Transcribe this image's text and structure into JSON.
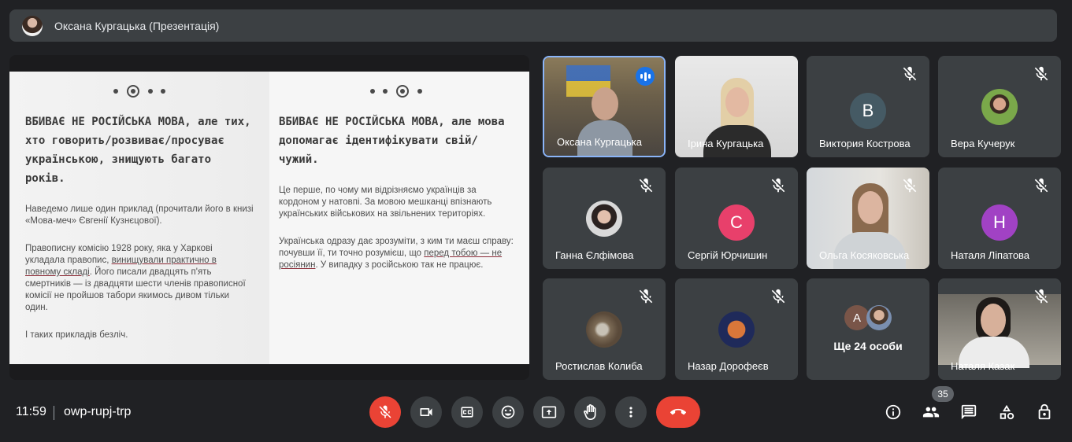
{
  "presenter": {
    "title": "Оксана Кургацька (Презентація)"
  },
  "slide": {
    "left_heading": "ВБИВАЄ НЕ РОСІЙСЬКА МОВА, але тих, хто говорить/розвиває/просуває українською, знищують багато років.",
    "left_p1": "Наведемо лише один приклад (прочитали його в книзі «Мова-меч» Євгенії Кузнєцової).",
    "left_p2a": "Правописну комісію 1928 року, яка у Харкові укладала правопис, ",
    "left_p2u": "винищували практично в повному складі",
    "left_p2b": ". Його писали двадцять п'ять смертників — із двадцяти шести членів правописної комісії не пройшов табори якимось дивом тільки один.",
    "left_p3": "І таких прикладів безліч.",
    "right_heading": "ВБИВАЄ НЕ РОСІЙСЬКА МОВА, але мова допомагає ідентифікувати свій/чужий.",
    "right_p1": "Це перше, по чому ми відрізняємо українців за кордоном у натовпі. За мовою мешканці впізнають українських військових на звільнених територіях.",
    "right_p2a": "Українська одразу дає зрозуміти, з ким ти маєш справу: почувши її, ти точно розумієш, що ",
    "right_p2u": "перед тобою — не росіянин",
    "right_p2b": ". У випадку з російською так не працює."
  },
  "tiles": [
    {
      "name": "Оксана Кургацька",
      "kind": "video",
      "active": true,
      "speaking": true
    },
    {
      "name": "Ірина Кургацька",
      "kind": "video"
    },
    {
      "name": "Виктория Кострова",
      "kind": "letter",
      "letter": "В",
      "color": "#455a64",
      "muted": true
    },
    {
      "name": "Вера Кучерук",
      "kind": "photo",
      "muted": true
    },
    {
      "name": "Ганна Єлфімова",
      "kind": "photo",
      "muted": true
    },
    {
      "name": "Сергій Юрчишин",
      "kind": "letter",
      "letter": "С",
      "color": "#e8406b",
      "muted": true
    },
    {
      "name": "Ольга Косяковська",
      "kind": "video",
      "muted": true
    },
    {
      "name": "Наталя Ліпатова",
      "kind": "letter",
      "letter": "Н",
      "color": "#a142c4",
      "muted": true
    },
    {
      "name": "Ростислав Колиба",
      "kind": "photo",
      "muted": true
    },
    {
      "name": "Назар Дорофеєв",
      "kind": "photo",
      "muted": true
    },
    {
      "name": "Ще 24 особи",
      "kind": "more",
      "letter": "А"
    },
    {
      "name": "Наталя Казак",
      "kind": "video",
      "muted": true
    }
  ],
  "bottom": {
    "time": "11:59",
    "meeting_code": "owp-rupj-trp",
    "participants_count": "35",
    "icons": [
      "mic-off-icon",
      "camera-icon",
      "captions-icon",
      "emoji-icon",
      "present-icon",
      "hand-icon",
      "more-icon",
      "end-call-icon",
      "info-icon",
      "people-icon",
      "chat-icon",
      "activities-icon",
      "host-controls-icon"
    ]
  },
  "colors": {
    "background": "#202124",
    "surface": "#3c4043",
    "danger": "#ea4335",
    "accent": "#8ab4f8"
  }
}
